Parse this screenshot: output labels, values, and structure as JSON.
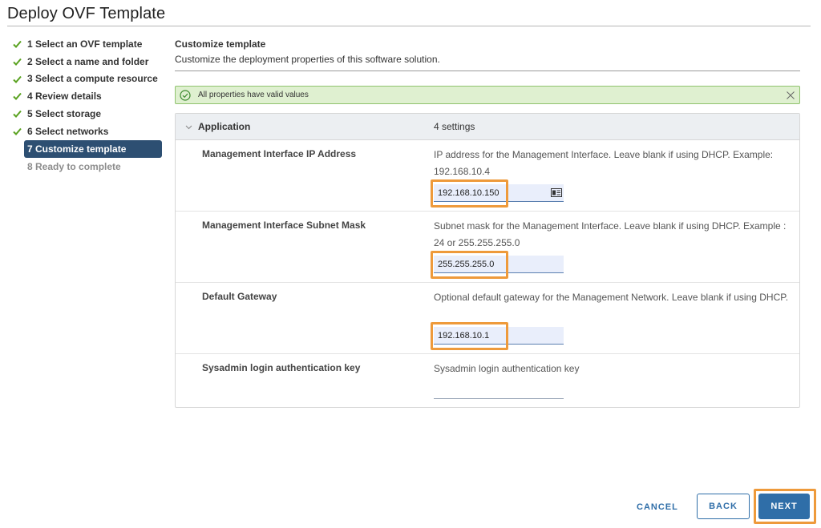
{
  "window": {
    "title": "Deploy OVF Template"
  },
  "steps": [
    {
      "label": "1 Select an OVF template",
      "state": "done"
    },
    {
      "label": "2 Select a name and folder",
      "state": "done"
    },
    {
      "label": "3 Select a compute resource",
      "state": "done"
    },
    {
      "label": "4 Review details",
      "state": "done"
    },
    {
      "label": "5 Select storage",
      "state": "done"
    },
    {
      "label": "6 Select networks",
      "state": "done"
    },
    {
      "label": "7 Customize template",
      "state": "active"
    },
    {
      "label": "8 Ready to complete",
      "state": "future"
    }
  ],
  "main": {
    "title": "Customize template",
    "subtitle": "Customize the deployment properties of this software solution."
  },
  "alert": {
    "message": "All properties have valid values",
    "status_color": "#8fc36e"
  },
  "table": {
    "group": "Application",
    "count": "4 settings",
    "rows": [
      {
        "label": "Management Interface IP Address",
        "desc": "IP address for the Management Interface. Leave blank if using DHCP. Example: 192.168.10.4",
        "value": "192.168.10.150"
      },
      {
        "label": "Management Interface Subnet Mask",
        "desc": "Subnet mask for the Management Interface. Leave blank if using DHCP. Example : 24 or 255.255.255.0",
        "value": "255.255.255.0"
      },
      {
        "label": "Default Gateway",
        "desc": "Optional default gateway for the Management Network. Leave blank if using DHCP.",
        "value": "192.168.10.1"
      },
      {
        "label": "Sysadmin login authentication key",
        "desc": "Sysadmin login authentication key",
        "value": ""
      }
    ]
  },
  "buttons": {
    "cancel": "CANCEL",
    "back": "BACK",
    "next": "NEXT"
  },
  "colors": {
    "accent": "#2f6ea8",
    "active_step": "#2d4f72",
    "highlight": "#ee9a3b",
    "check": "#5aa220"
  }
}
